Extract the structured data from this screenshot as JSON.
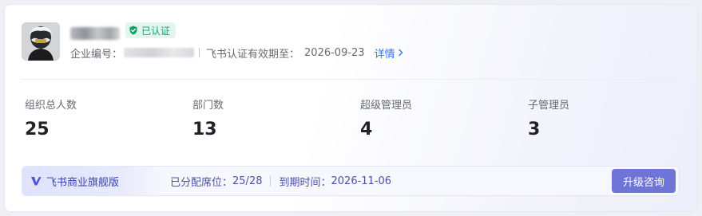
{
  "org": {
    "verified_label": "已认证",
    "code_prefix": "企业编号：",
    "cert_valid_label": "飞书认证有效期至：",
    "cert_valid_date": "2026-09-23",
    "detail_label": "详情"
  },
  "stats": [
    {
      "label": "组织总人数",
      "value": "25"
    },
    {
      "label": "部门数",
      "value": "13"
    },
    {
      "label": "超级管理员",
      "value": "4"
    },
    {
      "label": "子管理员",
      "value": "3"
    }
  ],
  "plan": {
    "name": "飞书商业旗舰版",
    "seats_label": "已分配席位：",
    "seats_value": "25/28",
    "expire_label": "到期时间：",
    "expire_date": "2026-11-06",
    "upgrade_label": "升级咨询"
  },
  "colors": {
    "accent": "#3370ff",
    "verified": "#14a06b",
    "plan_text": "#3b43a8",
    "upgrade_button": "#6f74d9"
  }
}
